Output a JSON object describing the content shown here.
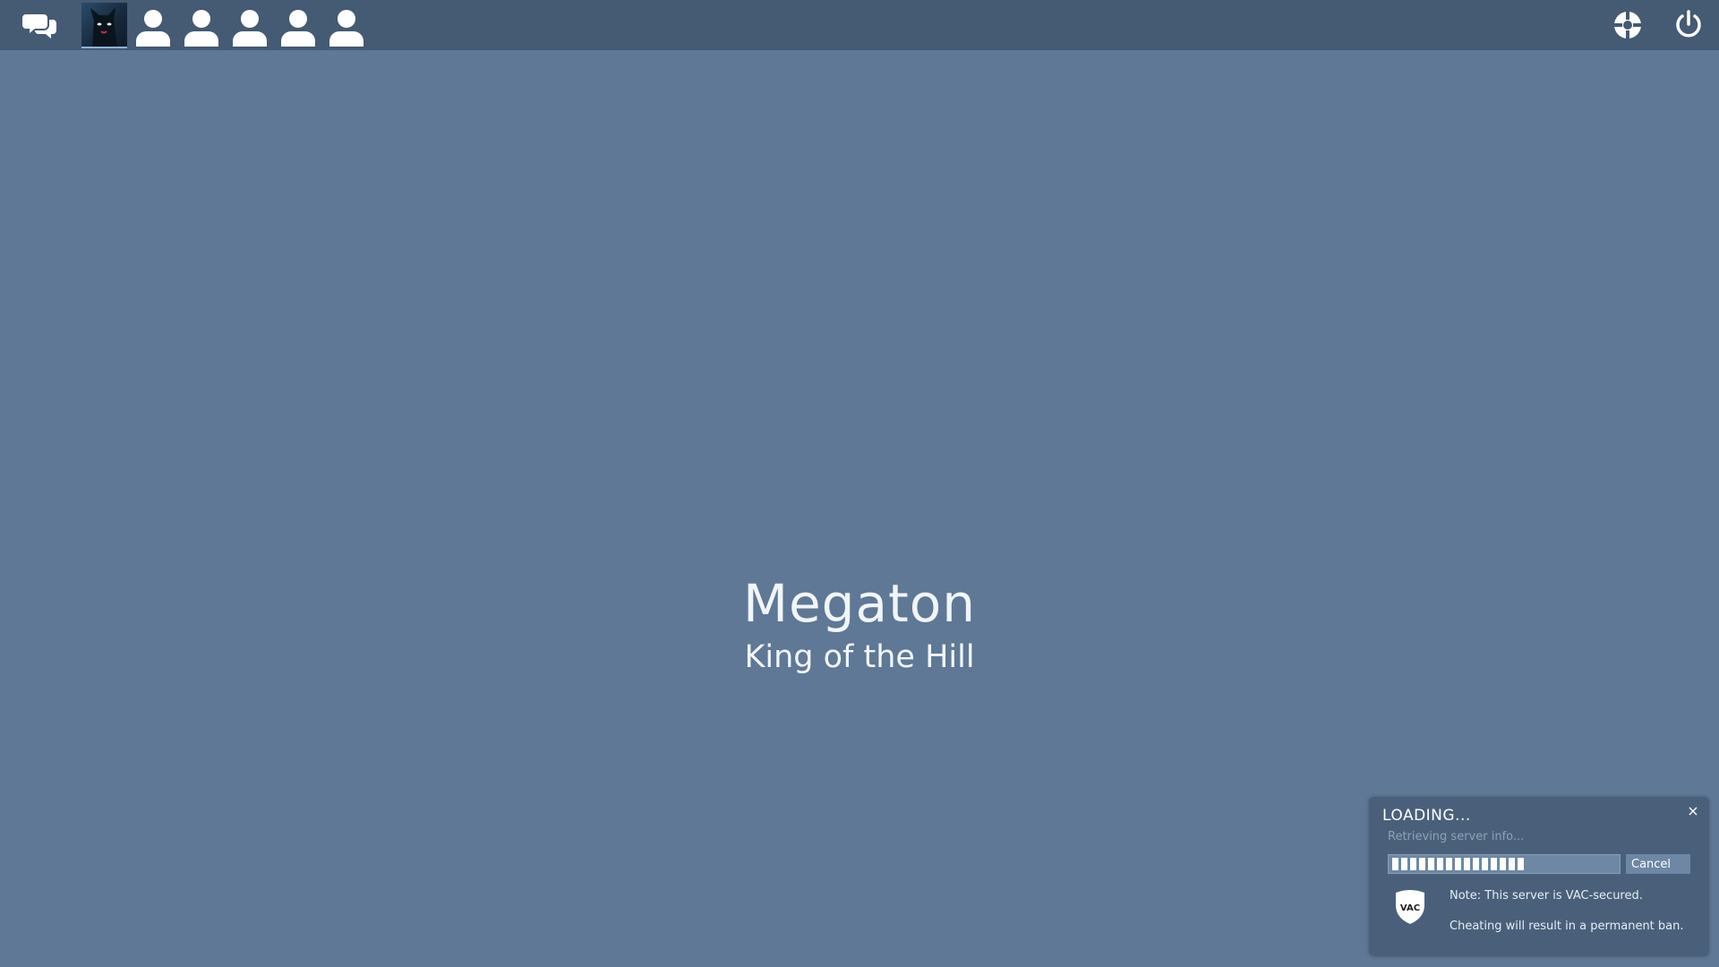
{
  "topbar": {
    "chat_icon": "chat-bubbles-icon",
    "self_avatar": "black-cat-avatar",
    "party_slots": [
      "person-icon",
      "person-icon",
      "person-icon",
      "person-icon",
      "person-icon"
    ],
    "settings_icon": "settings-gear-icon",
    "power_icon": "power-icon"
  },
  "map": {
    "name": "Megaton",
    "mode": "King of the Hill"
  },
  "loading_panel": {
    "title": "LOADING...",
    "close_label": "×",
    "status": "Retrieving server info...",
    "progress_segments": 15,
    "cancel_label": "Cancel",
    "vac_badge_text": "VAC",
    "note": "Note: This server is VAC-secured.",
    "warning": "Cheating will result in a permanent ban."
  },
  "colors": {
    "background": "#5e7896",
    "topbar": "#455a73",
    "panel": "#4a607a",
    "progress_track": "#6d87a5",
    "text_primary": "#ffffff",
    "text_muted": "#8ea1b6"
  }
}
